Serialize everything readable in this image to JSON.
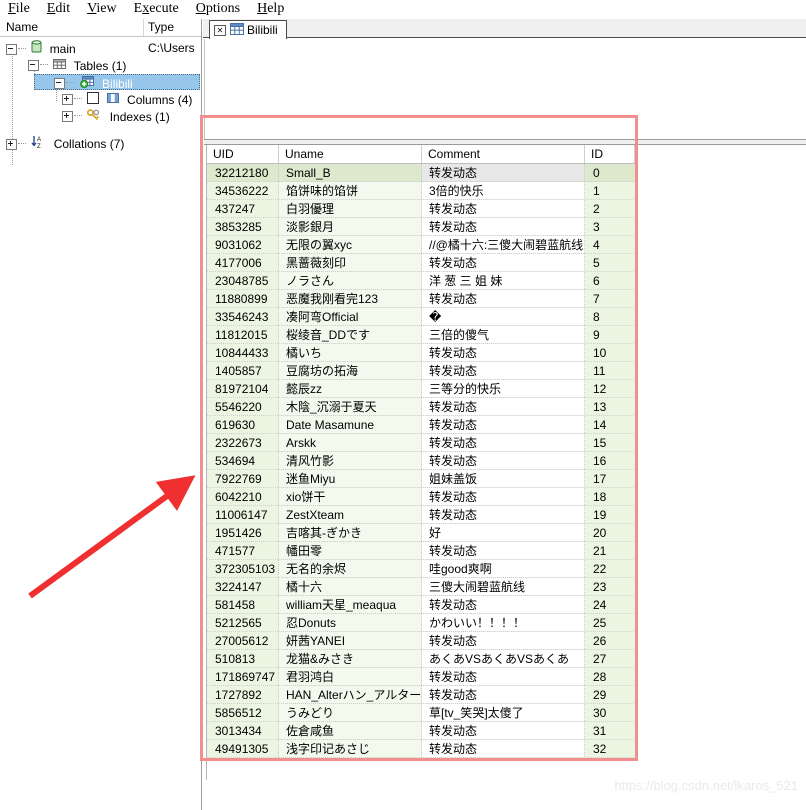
{
  "menu": {
    "items": [
      {
        "label": "File",
        "mnemonic": "F"
      },
      {
        "label": "Edit",
        "mnemonic": "E"
      },
      {
        "label": "View",
        "mnemonic": "V"
      },
      {
        "label": "Execute",
        "mnemonic": "x"
      },
      {
        "label": "Options",
        "mnemonic": "O"
      },
      {
        "label": "Help",
        "mnemonic": "H"
      }
    ]
  },
  "tree": {
    "header": {
      "name": "Name",
      "type": "Type"
    },
    "type_value": "C:\\Users",
    "nodes": [
      {
        "label": "main",
        "icon": "database-icon",
        "expander": "minus",
        "selected": false
      },
      {
        "label": "Tables (1)",
        "icon": "tables-icon",
        "expander": "minus",
        "selected": false
      },
      {
        "label": "Bilibili",
        "icon": "table-add-icon",
        "expander": "minus",
        "selected": true
      },
      {
        "label": "Columns (4)",
        "icon": "columns-icon",
        "expander": "plus",
        "selected": false
      },
      {
        "label": "Indexes (1)",
        "icon": "key-icon",
        "expander": "plus",
        "selected": false
      },
      {
        "label": "Collations (7)",
        "icon": "sort-az-icon",
        "expander": "plus",
        "selected": false
      }
    ]
  },
  "tabs": {
    "active": "Bilibili",
    "close_glyph": "✕",
    "items": [
      {
        "label": "Bilibili",
        "icon": "grid-icon"
      }
    ]
  },
  "grid": {
    "columns": [
      "UID",
      "Uname",
      "Comment",
      "ID"
    ],
    "rows": [
      [
        "32212180",
        "Small_B",
        "转发动态",
        "0"
      ],
      [
        "34536222",
        "馅饼味的馅饼",
        "3倍的快乐",
        "1"
      ],
      [
        "437247",
        "白羽優理",
        "转发动态",
        "2"
      ],
      [
        "3853285",
        "淡影銀月",
        "转发动态",
        "3"
      ],
      [
        "9031062",
        "无限の翼xyc",
        "//@橘十六:三傻大闹碧蓝航线",
        "4"
      ],
      [
        "4177006",
        "黑蔷薇刻印",
        "转发动态",
        "5"
      ],
      [
        "23048785",
        "ノラさん",
        "洋 葱 三 姐 妹",
        "6"
      ],
      [
        "11880899",
        "恶魔我刚看完123",
        "转发动态",
        "7"
      ],
      [
        "33546243",
        "凑阿弯Official",
        "�",
        "8"
      ],
      [
        "11812015",
        "桜绫音_DDです",
        "三倍的傻气",
        "9"
      ],
      [
        "10844433",
        "橘いち",
        "转发动态",
        "10"
      ],
      [
        "1405857",
        "豆腐坊の拓海",
        "转发动态",
        "11"
      ],
      [
        "81972104",
        "懿辰zz",
        "三等分的快乐",
        "12"
      ],
      [
        "5546220",
        "木陰_沉溺于夏天",
        "转发动态",
        "13"
      ],
      [
        "619630",
        "Date Masamune",
        "转发动态",
        "14"
      ],
      [
        "2322673",
        "Arskk",
        "转发动态",
        "15"
      ],
      [
        "534694",
        "清风竹影",
        "转发动态",
        "16"
      ],
      [
        "7922769",
        "迷鱼Miyu",
        "姐妹盖饭",
        "17"
      ],
      [
        "6042210",
        "xio饼干",
        "转发动态",
        "18"
      ],
      [
        "11006147",
        "ZestXteam",
        "转发动态",
        "19"
      ],
      [
        "1951426",
        "吉喀其-ぎかき",
        "好",
        "20"
      ],
      [
        "471577",
        "幡田零",
        "转发动态",
        "21"
      ],
      [
        "372305103",
        "无名的余烬",
        "哇good爽啊",
        "22"
      ],
      [
        "3224147",
        "橘十六",
        "三傻大闹碧蓝航线",
        "23"
      ],
      [
        "581458",
        "william天星_meaqua",
        "转发动态",
        "24"
      ],
      [
        "5212565",
        "忍Donuts",
        "かわいい！！！！",
        "25"
      ],
      [
        "27005612",
        "妍茜YANEI",
        "转发动态",
        "26"
      ],
      [
        "510813",
        "龙猫&みさき",
        "あくあVSあくあVSあくあ",
        "27"
      ],
      [
        "171869747",
        "君羽鸿白",
        "转发动态",
        "28"
      ],
      [
        "1727892",
        "HAN_Alterハン_アルター",
        "转发动态",
        "29"
      ],
      [
        "5856512",
        "うみどり",
        "草[tv_笑哭]太傻了",
        "30"
      ],
      [
        "3013434",
        "佐倉咸鱼",
        "转发动态",
        "31"
      ],
      [
        "49491305",
        "浅字印记あさじ",
        "转发动态",
        "32"
      ]
    ],
    "current_row_index": 0
  },
  "annotations": {
    "highlight_color": "#f28e8e",
    "arrow_color": "#f03030"
  },
  "watermark": {
    "text": "https://blog.csdn.net/lkaros_521"
  }
}
